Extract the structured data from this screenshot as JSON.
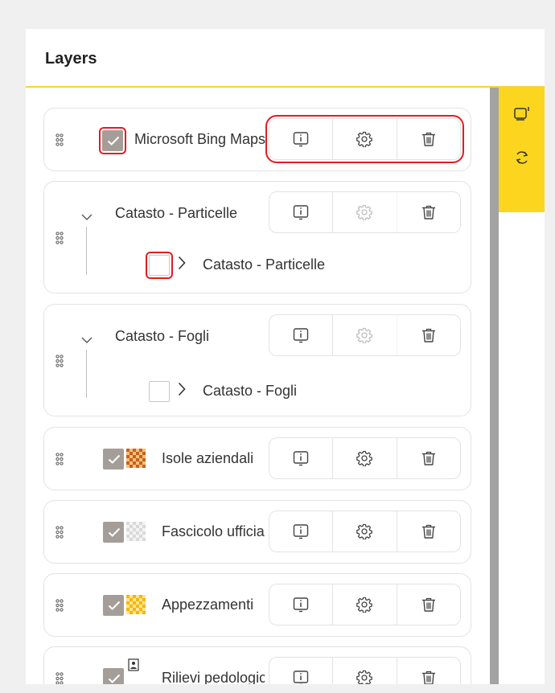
{
  "panel": {
    "title": "Layers"
  },
  "colors": {
    "accent": "#fcd51f",
    "highlight": "#e01e1e",
    "checkbox": "#a59e98",
    "scrollbar": "#a3a3a3"
  },
  "side_toolbar": [
    {
      "icon": "window-export-icon"
    },
    {
      "icon": "refresh-icon"
    }
  ],
  "layers": [
    {
      "name": "Microsoft Bing Maps",
      "checked": true,
      "settings_enabled": true
    },
    {
      "name": "Catasto - Particelle",
      "group": true,
      "expanded": true,
      "child": {
        "name": "Catasto - Particelle",
        "checked": false
      },
      "settings_enabled": false
    },
    {
      "name": "Catasto - Fogli",
      "group": true,
      "expanded": true,
      "child": {
        "name": "Catasto - Fogli",
        "checked": false
      },
      "settings_enabled": false
    },
    {
      "name": "Isole aziendali",
      "checked": true,
      "swatch": "orange-checker",
      "settings_enabled": true
    },
    {
      "name": "Fascicolo ufficiale",
      "checked": true,
      "swatch": "grey-checker",
      "settings_enabled": true
    },
    {
      "name": "Appezzamenti",
      "checked": true,
      "swatch": "yellow-checker",
      "settings_enabled": true
    },
    {
      "name": "Rilievi pedologici",
      "checked": true,
      "swatch": "image",
      "settings_enabled": true
    }
  ]
}
